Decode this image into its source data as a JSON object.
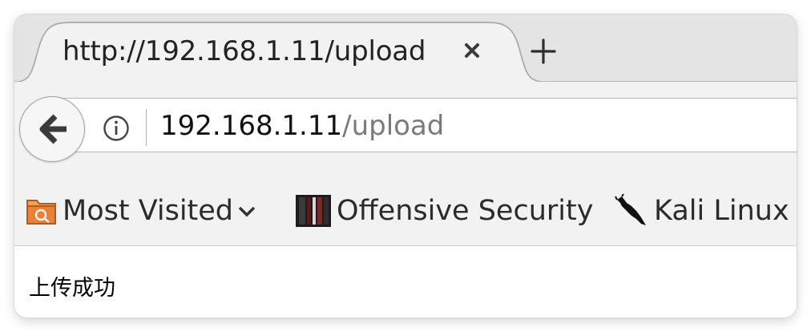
{
  "tab": {
    "title": "http://192.168.1.11/upload",
    "close_icon": "close-icon",
    "new_tab_icon": "plus-icon"
  },
  "nav": {
    "back_icon": "arrow-left-icon",
    "info_icon": "info-icon",
    "url_host": "192.168.1.11",
    "url_path": "/upload"
  },
  "bookmarks": {
    "items": [
      {
        "label": "Most Visited",
        "icon": "folder-icon",
        "has_dropdown": true
      },
      {
        "label": "Offensive Security",
        "icon": "offsec-logo-icon"
      },
      {
        "label": "Kali Linux",
        "icon": "kali-dragon-icon"
      }
    ]
  },
  "page": {
    "message": "上传成功"
  },
  "colors": {
    "tabstrip_bg": "#e4e4e4",
    "toolbar_bg": "#f2f2f2",
    "url_path_color": "#7a7a7a",
    "folder_orange": "#e8823a"
  }
}
